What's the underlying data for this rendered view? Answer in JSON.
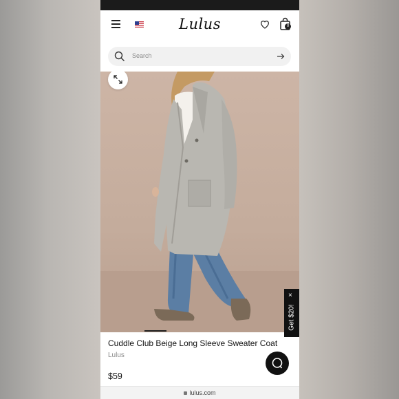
{
  "brand_logo": "Lulus",
  "header": {
    "menu_icon": "hamburger-menu-icon",
    "flag_icon": "us-flag-icon",
    "wishlist_icon": "heart-icon",
    "bag_icon": "shopping-bag-icon",
    "bag_count": "0"
  },
  "search": {
    "placeholder": "Search",
    "submit_icon": "arrow-right-icon"
  },
  "gallery": {
    "expand_icon": "expand-icon",
    "image_description_hidden": true
  },
  "promo": {
    "label": "Get $20!",
    "close": "×"
  },
  "product": {
    "title": "Cuddle Club Beige Long Sleeve Sweater Coat",
    "brand": "Lulus",
    "price": "$59"
  },
  "chat": {
    "icon": "chat-bubble-icon"
  },
  "browser": {
    "url": "lulus.com"
  },
  "colors": {
    "accent": "#111111",
    "background_blur": "#c6c1bb",
    "image_backdrop": "#c4ac9c"
  }
}
